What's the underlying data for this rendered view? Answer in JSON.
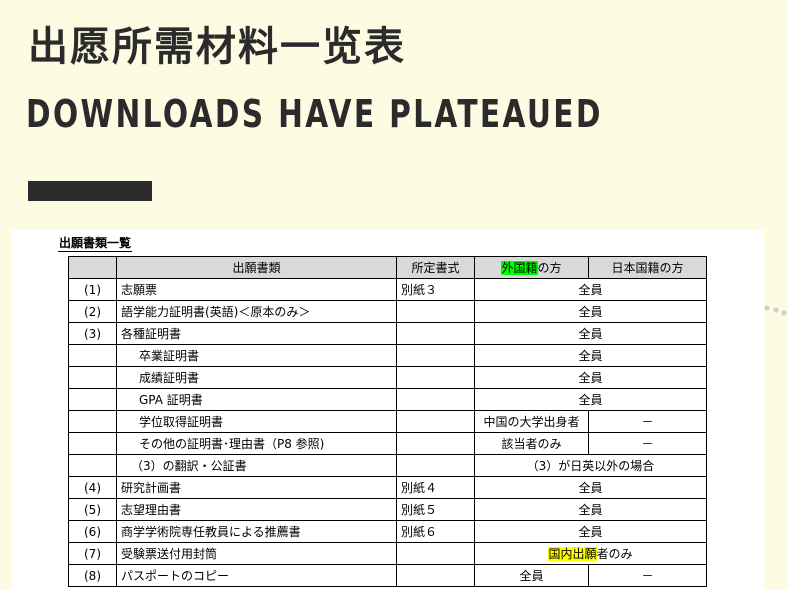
{
  "header": {
    "title_cn": "出愿所需材料一览表",
    "title_en": "DOWNLOADS HAVE PLATEAUED"
  },
  "document": {
    "title": "出願書類一覧",
    "columns": {
      "num": "",
      "doc": "出願書類",
      "form": "所定書式",
      "foreign_hl": "外国籍",
      "foreign_rest": "の方",
      "japanese": "日本国籍の方"
    },
    "rows": [
      {
        "num": "(1)",
        "name": "志願票",
        "form": "別紙３",
        "target": "全員"
      },
      {
        "num": "(2)",
        "name": "語学能力証明書(英語)＜原本のみ＞",
        "form": "",
        "target": "全員"
      },
      {
        "num": "(3)",
        "name": "各種証明書",
        "form": "",
        "target": "全員"
      },
      {
        "num": "",
        "name": "卒業証明書",
        "form": "",
        "target": "全員"
      },
      {
        "num": "",
        "name": "成績証明書",
        "form": "",
        "target": "全員"
      },
      {
        "num": "",
        "name": "GPA 証明書",
        "form": "",
        "target": "全員"
      },
      {
        "num": "",
        "name": "学位取得証明書",
        "form": "",
        "foreign": "中国の大学出身者",
        "japanese": "－"
      },
      {
        "num": "",
        "name": "その他の証明書･理由書（P8 参照)",
        "form": "",
        "foreign": "該当者のみ",
        "japanese": "－"
      },
      {
        "num": "",
        "name": "（3）の翻訳・公証書",
        "form": "",
        "target": "（3）が日英以外の場合"
      },
      {
        "num": "(4)",
        "name": "研究計画書",
        "form": "別紙４",
        "target": "全員"
      },
      {
        "num": "(5)",
        "name": "志望理由書",
        "form": "別紙５",
        "target": "全員"
      },
      {
        "num": "(6)",
        "name": "商学学術院専任教員による推薦書",
        "form": "別紙６",
        "target": "全員"
      },
      {
        "num": "(7)",
        "name": "受験票送付用封筒",
        "form": "",
        "target_hl": "国内出願",
        "target_rest": "者のみ"
      },
      {
        "num": "(8)",
        "name": "パスポートのコピー",
        "form": "",
        "foreign": "全員",
        "japanese": "－"
      }
    ]
  },
  "colors": {
    "background": "#fdfce3",
    "text": "#2b2b2b",
    "highlight_green": "#00ff00",
    "highlight_yellow": "#ffff00",
    "header_gray": "#d9d9d9"
  }
}
